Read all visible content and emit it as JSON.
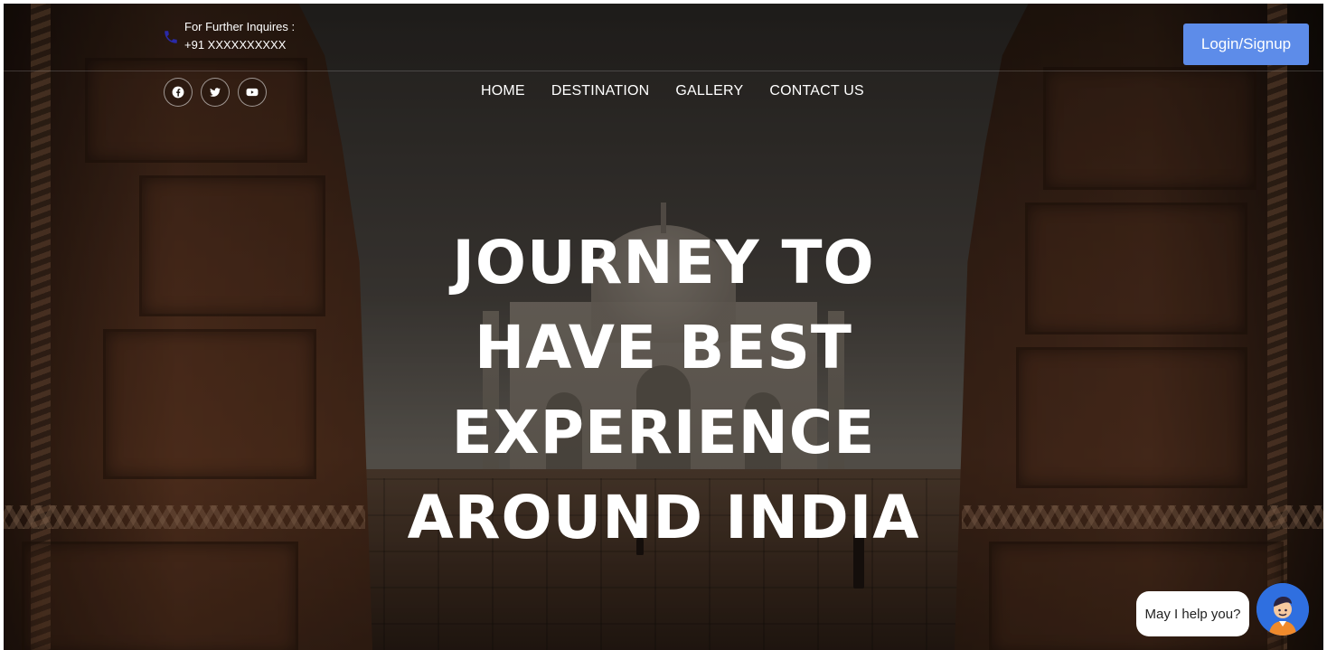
{
  "header": {
    "inquiry_label": "For Further Inquires :",
    "phone": "+91 XXXXXXXXXX",
    "login_label": "Login/Signup"
  },
  "social": [
    "facebook-icon",
    "twitter-icon",
    "youtube-icon"
  ],
  "nav": {
    "items": [
      {
        "label": "HOME"
      },
      {
        "label": "DESTINATION"
      },
      {
        "label": "GALLERY"
      },
      {
        "label": "CONTACT US"
      }
    ]
  },
  "hero": {
    "lines": [
      "JOURNEY TO",
      "HAVE BEST",
      "EXPERIENCE",
      "AROUND INDIA"
    ]
  },
  "chat": {
    "prompt": "May I help you?"
  },
  "colors": {
    "accent": "#5d8ce9",
    "chat_avatar": "#2f6fe0",
    "phone_icon": "#2a2aa8"
  }
}
